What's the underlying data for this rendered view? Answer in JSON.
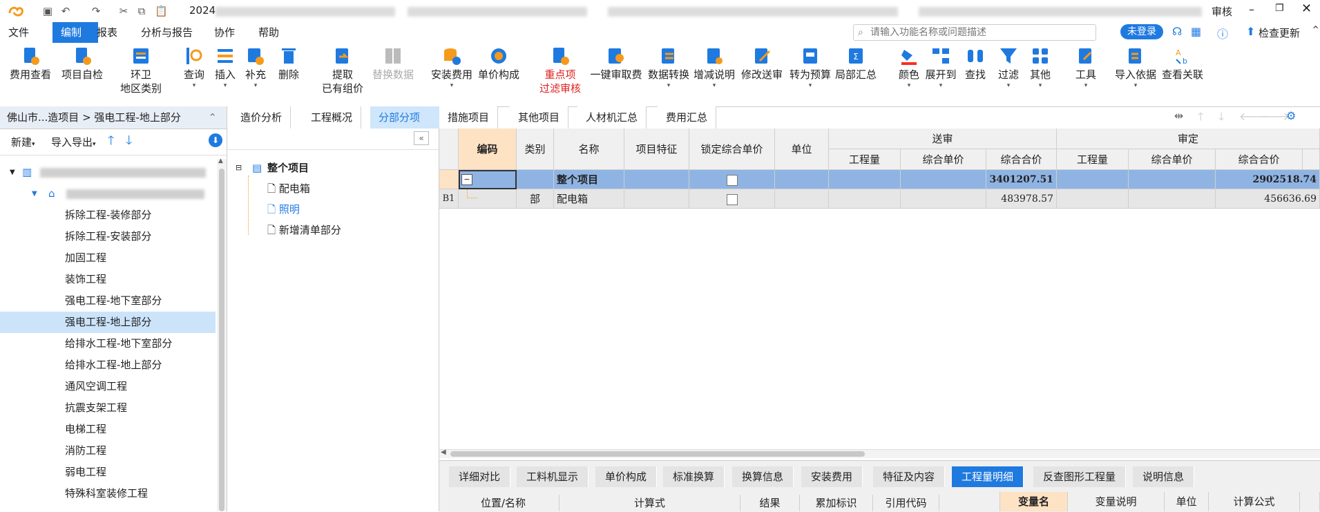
{
  "titlebar": {
    "doc_prefix": "2024",
    "right_text": "审核",
    "window_controls": [
      "minimize",
      "restore",
      "close"
    ]
  },
  "menu": {
    "items": [
      "文件",
      "编制",
      "报表",
      "分析与报告",
      "协作",
      "帮助"
    ],
    "search_placeholder": "请输入功能名称或问题描述",
    "login_label": "未登录",
    "update_label": "检查更新"
  },
  "ribbon": {
    "buttons": [
      {
        "label": "费用查看"
      },
      {
        "label": "项目自检"
      },
      {
        "label": "环卫",
        "label2": "地区类别"
      },
      {
        "label": "查询"
      },
      {
        "label": "插入"
      },
      {
        "label": "补充"
      },
      {
        "label": "删除"
      },
      {
        "label": "提取",
        "label2": "已有组价"
      },
      {
        "label": "替换数据"
      },
      {
        "label": "安装费用"
      },
      {
        "label": "单价构成"
      },
      {
        "label": "重点项",
        "label2": "过滤审核"
      },
      {
        "label": "一键审取费"
      },
      {
        "label": "数据转换"
      },
      {
        "label": "增减说明"
      },
      {
        "label": "修改送审"
      },
      {
        "label": "转为预算"
      },
      {
        "label": "局部汇总"
      },
      {
        "label": "颜色"
      },
      {
        "label": "展开到"
      },
      {
        "label": "查找"
      },
      {
        "label": "过滤"
      },
      {
        "label": "其他"
      },
      {
        "label": "工具"
      },
      {
        "label": "导入依据"
      },
      {
        "label": "查看关联"
      }
    ]
  },
  "left": {
    "breadcrumb": "佛山市...造项目 > 强电工程-地上部分",
    "new_label": "新建",
    "import_label": "导入导出",
    "items": [
      "拆除工程-装修部分",
      "拆除工程-安装部分",
      "加固工程",
      "装饰工程",
      "强电工程-地下室部分",
      "强电工程-地上部分",
      "给排水工程-地下室部分",
      "给排水工程-地上部分",
      "通风空调工程",
      "抗震支架工程",
      "电梯工程",
      "消防工程",
      "弱电工程",
      "特殊科室装修工程"
    ],
    "selected": "强电工程-地上部分"
  },
  "mid": {
    "root": "整个项目",
    "children": [
      "配电箱",
      "照明",
      "新增清单部分"
    ]
  },
  "tabs": [
    "造价分析",
    "工程概况",
    "分部分项",
    "措施项目",
    "其他项目",
    "人材机汇总",
    "费用汇总"
  ],
  "active_tab": "分部分项",
  "grid": {
    "headers": {
      "code": "编码",
      "type": "类别",
      "name": "名称",
      "feature": "项目特征",
      "lock": "锁定综合单价",
      "unit": "单位",
      "group_submit": "送审",
      "group_audit": "审定",
      "qty": "工程量",
      "unit_price": "综合单价",
      "total_price": "综合合价"
    },
    "rows": [
      {
        "idx": "",
        "type": "",
        "name": "整个项目",
        "submit_total": "3401207.51",
        "audit_total": "2902518.74"
      },
      {
        "idx": "B1",
        "type": "部",
        "name": "配电箱",
        "submit_total": "483978.57",
        "audit_total": "456636.69"
      }
    ]
  },
  "bottom_tabs": [
    "详细对比",
    "工料机显示",
    "单价构成",
    "标准换算",
    "换算信息",
    "安装费用",
    "特征及内容",
    "工程量明细",
    "反查图形工程量",
    "说明信息"
  ],
  "bottom_active": "工程量明细",
  "bottom_left_headers": [
    "位置/名称",
    "计算式",
    "结果",
    "累加标识",
    "引用代码"
  ],
  "bottom_right_headers": [
    "变量名",
    "变量说明",
    "单位",
    "计算公式"
  ],
  "colors": {
    "accent": "#1f7ae0",
    "selected_row": "#8fb4e3",
    "code_header": "#fde2c4"
  }
}
